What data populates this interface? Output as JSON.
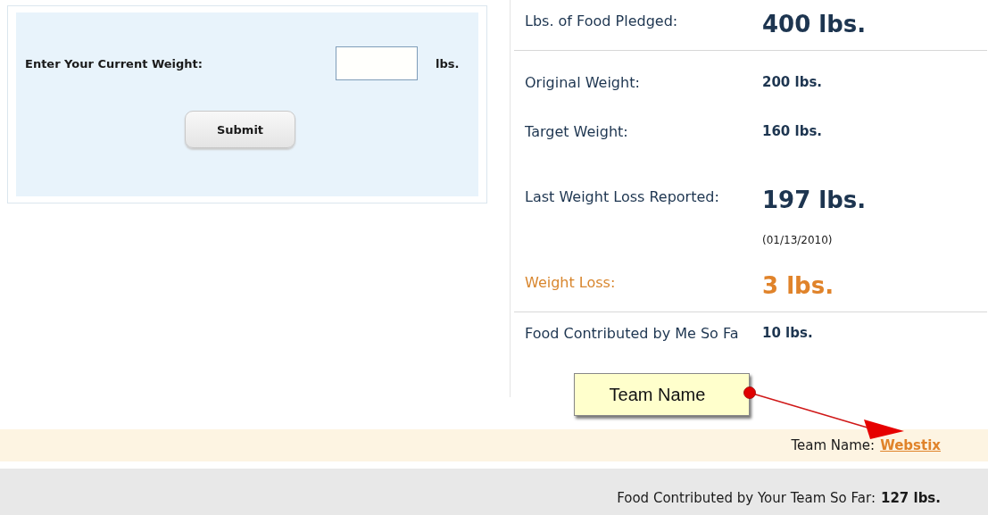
{
  "weight_form": {
    "label": "Enter Your Current Weight:",
    "unit": "lbs.",
    "button": "Submit"
  },
  "stats": {
    "sections": [
      [
        {
          "kind": "headline",
          "label": "Lbs. of Food Pledged:",
          "value": "400 lbs."
        }
      ],
      [
        {
          "kind": "plain",
          "label": "Original Weight:",
          "value": "200 lbs."
        },
        {
          "kind": "plain",
          "label": "Target Weight:",
          "value": "160 lbs."
        },
        {
          "kind": "large",
          "label": "Last Weight Loss Reported:",
          "value": "197 lbs."
        },
        {
          "kind": "note",
          "value": "(01/13/2010)"
        },
        {
          "kind": "highlight",
          "label": "Weight Loss:",
          "value": "3 lbs."
        }
      ],
      [
        {
          "kind": "plain",
          "label": "Food Contributed by Me So Fa",
          "value": "10 lbs."
        }
      ]
    ]
  },
  "team": {
    "label": "Team Name:",
    "link": "Webstix"
  },
  "team_total": {
    "label": "Food Contributed by Your Team So Far:",
    "value": "127 lbs."
  },
  "callout": {
    "text": "Team Name"
  }
}
